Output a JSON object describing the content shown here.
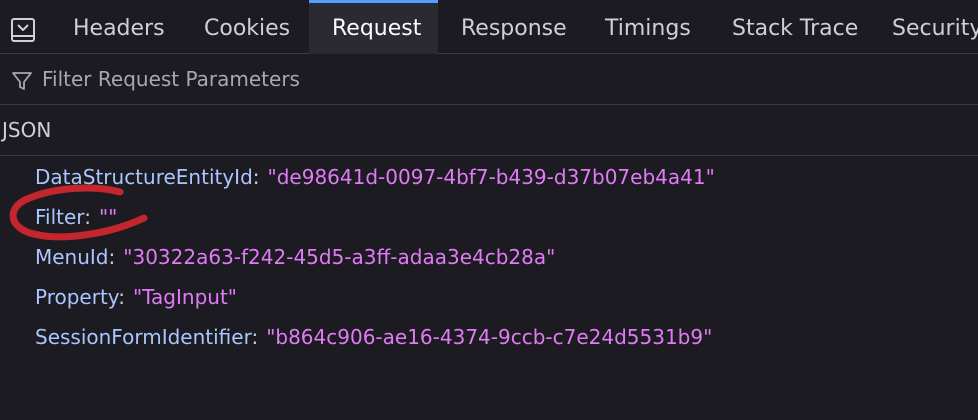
{
  "tabs": [
    {
      "label": "Headers",
      "selected": false
    },
    {
      "label": "Cookies",
      "selected": false
    },
    {
      "label": "Request",
      "selected": true
    },
    {
      "label": "Response",
      "selected": false
    },
    {
      "label": "Timings",
      "selected": false
    },
    {
      "label": "Stack Trace",
      "selected": false
    },
    {
      "label": "Security",
      "selected": false
    }
  ],
  "filter": {
    "placeholder": "Filter Request Parameters",
    "value": ""
  },
  "section": {
    "title": "JSON"
  },
  "params": [
    {
      "key": "DataStructureEntityId",
      "colon": ":",
      "value": "\"de98641d-0097-4bf7-b439-d37b07eb4a41\""
    },
    {
      "key": "Filter",
      "colon": ":",
      "value": "\"\""
    },
    {
      "key": "MenuId",
      "colon": ":",
      "value": "\"30322a63-f242-45d5-a3ff-adaa3e4cb28a\""
    },
    {
      "key": "Property",
      "colon": ":",
      "value": "\"TagInput\""
    },
    {
      "key": "SessionFormIdentifier",
      "colon": ":",
      "value": "\"b864c906-ae16-4374-9ccb-c7e24d5531b9\""
    }
  ],
  "colors": {
    "background": "#1c1b22",
    "selected_tab_accent": "#54a0ff",
    "key": "#a9c6ff",
    "string_value": "#e17bf5",
    "annotation": "#c4262e"
  },
  "icons": {
    "dock": "dock-side-icon",
    "filter": "filter-funnel-icon"
  }
}
